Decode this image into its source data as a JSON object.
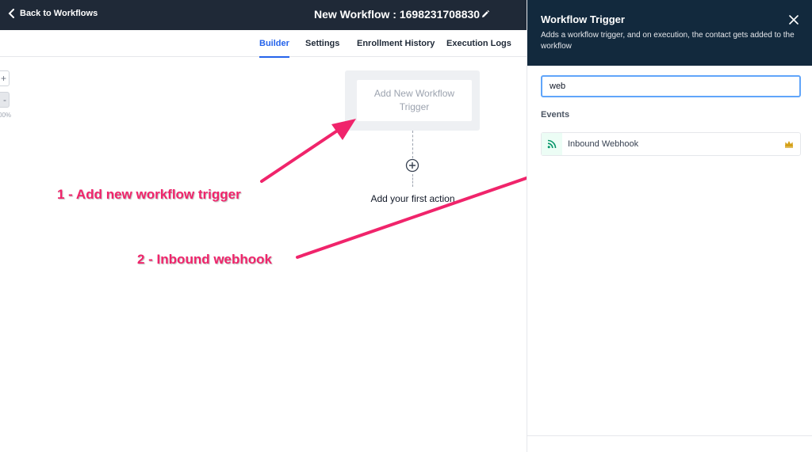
{
  "header": {
    "back_label": "Back to Workflows",
    "workflow_title": "New Workflow : 1698231708830"
  },
  "tabs": [
    {
      "label": "Builder",
      "active": true
    },
    {
      "label": "Settings",
      "active": false
    },
    {
      "label": "Enrollment History",
      "active": false
    },
    {
      "label": "Execution Logs",
      "active": false
    }
  ],
  "canvas": {
    "zoom_in_label": "+",
    "zoom_out_label": "-",
    "zoom_level": "00%",
    "trigger_node_label": "Add New Workflow Trigger",
    "first_action_label": "Add your first action"
  },
  "annotations": {
    "step1": "1 - Add new workflow trigger",
    "step2": "2 - Inbound webhook"
  },
  "panel": {
    "title": "Workflow Trigger",
    "description": "Adds a workflow trigger, and on execution, the contact gets added to the workflow",
    "search_value": "web",
    "events_label": "Events",
    "event_items": [
      {
        "label": "Inbound Webhook",
        "icon": "rss-icon",
        "premium_icon": "crown-icon"
      }
    ]
  },
  "colors": {
    "header_bg": "#1f2937",
    "panel_header_bg": "#12293d",
    "accent_blue": "#2563eb",
    "annotation_pink": "#f0246b",
    "crown_gold": "#d4a017",
    "webhook_green": "#059669"
  }
}
